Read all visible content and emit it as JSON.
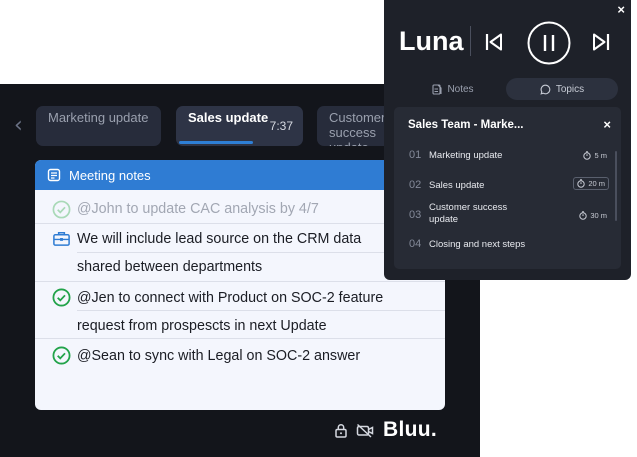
{
  "meeting": {
    "agenda_tabs": [
      {
        "label": "Marketing update"
      },
      {
        "label": "Sales update",
        "time": "7:37",
        "progress": 0.58
      },
      {
        "label": "Customer success update"
      }
    ],
    "notes_title": "Meeting notes",
    "notes": [
      {
        "text": "@John to update CAC analysis by 4/7",
        "icon": "check-circle-icon",
        "status": "done-faded"
      },
      {
        "text": "We will include lead source on the CRM data",
        "continuation": "shared between departments",
        "icon": "briefcase-icon"
      },
      {
        "text": "@Jen to connect with Product on SOC-2 feature",
        "continuation": "request from prospescts in next Update",
        "icon": "check-circle-icon"
      },
      {
        "text": "@Sean to sync with Legal on SOC-2 answer",
        "icon": "check-circle-icon"
      }
    ],
    "logo": "Bluu."
  },
  "luna": {
    "title": "Luna",
    "close": "×",
    "tabs": {
      "notes": "Notes",
      "topics": "Topics"
    },
    "topics_title": "Sales Team - Marke...",
    "topics_close": "×",
    "topics": [
      {
        "num": "01",
        "label": "Marketing update",
        "duration": "5 m"
      },
      {
        "num": "02",
        "label": "Sales update",
        "duration": "20 m",
        "active": true
      },
      {
        "num": "03",
        "label": "Customer success update",
        "label_line1": "Customer success",
        "label_line2": "update",
        "duration": "30 m"
      },
      {
        "num": "04",
        "label": "Closing and next steps"
      }
    ]
  },
  "colors": {
    "accent": "#2f7cd3",
    "check_green": "#22a34a",
    "dark_bg": "#13151b",
    "luna_bg": "#1e2129"
  }
}
